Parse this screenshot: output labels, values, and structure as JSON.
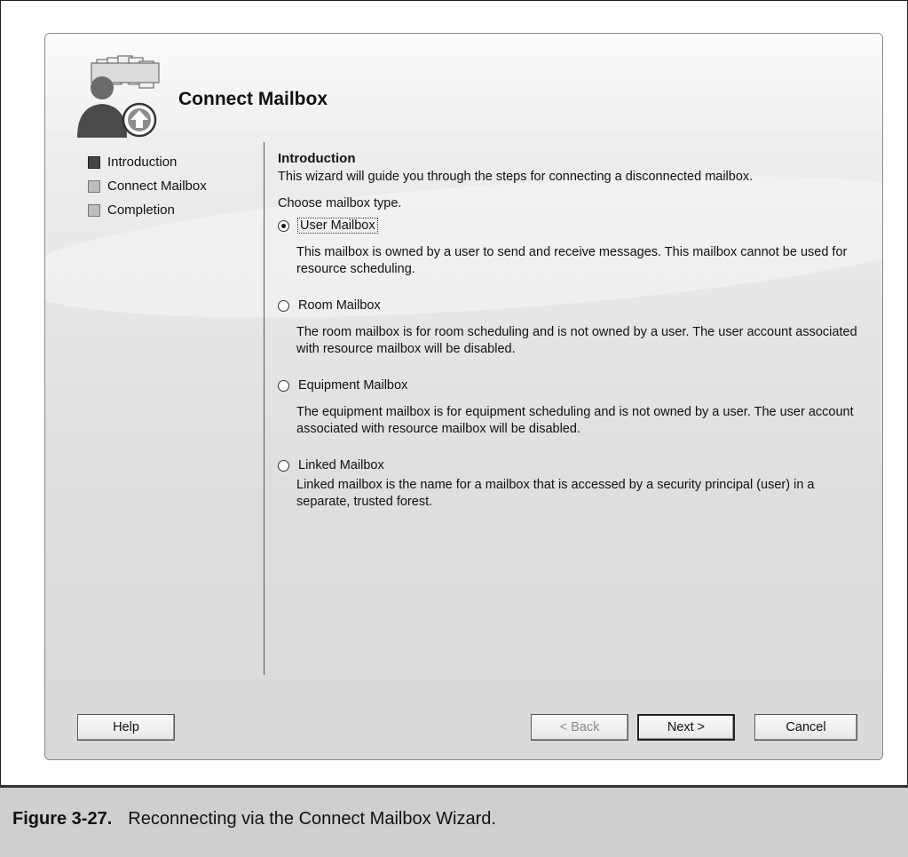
{
  "wizard": {
    "title": "Connect Mailbox",
    "icon": "mailbox-user-arrow-icon",
    "steps": [
      {
        "label": "Introduction",
        "active": true
      },
      {
        "label": "Connect Mailbox",
        "active": false
      },
      {
        "label": "Completion",
        "active": false
      }
    ],
    "intro_heading": "Introduction",
    "intro_text": "This wizard will guide you through the steps for connecting a disconnected mailbox.",
    "choose_label": "Choose mailbox type.",
    "options": [
      {
        "label": "User Mailbox",
        "checked": true,
        "description": "This mailbox is owned by a user to send and receive messages. This mailbox cannot be used for resource scheduling."
      },
      {
        "label": "Room Mailbox",
        "checked": false,
        "description": "The room mailbox is for room scheduling and is not owned by a user. The user account associated with resource mailbox will be disabled."
      },
      {
        "label": "Equipment Mailbox",
        "checked": false,
        "description": "The equipment mailbox is for equipment scheduling and is not owned by a user. The user account associated with resource mailbox will be disabled."
      },
      {
        "label": "Linked Mailbox",
        "checked": false,
        "description": "Linked mailbox is the name for a mailbox that is accessed by a security principal (user) in a separate, trusted forest."
      }
    ],
    "buttons": {
      "help": "Help",
      "back": "< Back",
      "next": "Next >",
      "cancel": "Cancel"
    }
  },
  "figure": {
    "number": "Figure 3-27.",
    "caption": "Reconnecting via the Connect Mailbox Wizard."
  }
}
